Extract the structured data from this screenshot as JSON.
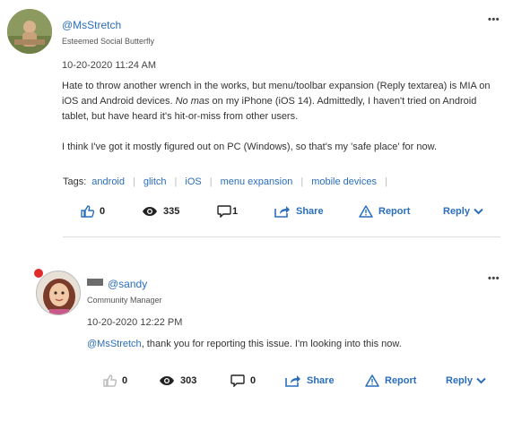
{
  "posts": [
    {
      "username": "@MsStretch",
      "rank": "Esteemed Social Butterfly",
      "timestamp": "10-20-2020 11:24 AM",
      "body": {
        "p1_a": "Hate to throw another wrench in the works, but menu/toolbar expansion (Reply textarea) is MIA on iOS and Android devices.  ",
        "p1_em": "No mas",
        "p1_b": " on my iPhone (iOS 14).  Admittedly, I haven't tried on Android tablet, but have heard it's hit-or-miss from other users.",
        "p2": "I think I've got it mostly figured out on PC (Windows), so that's my 'safe place' for now."
      },
      "tags_label": "Tags:",
      "tags": [
        "android",
        "glitch",
        "iOS",
        "menu expansion",
        "mobile devices"
      ],
      "likes": "0",
      "views": "335",
      "comments": "1",
      "share_label": "Share",
      "report_label": "Report",
      "reply_label": "Reply",
      "more_label": "•••"
    },
    {
      "username": "@sandy",
      "rank": "Community Manager",
      "timestamp": "10-20-2020 12:22 PM",
      "body": {
        "mention": "@MsStretch",
        "text": ", thank you for reporting this issue.  I'm looking into this now."
      },
      "likes": "0",
      "views": "303",
      "comments": "0",
      "share_label": "Share",
      "report_label": "Report",
      "reply_label": "Reply",
      "more_label": "•••"
    }
  ],
  "colors": {
    "link": "#2a6ebb",
    "text": "#333333",
    "divider": "#dddddd",
    "badge": "#e02b2b"
  },
  "icons": [
    "thumbs-up-icon",
    "eye-icon",
    "comment-icon",
    "share-icon",
    "report-icon",
    "chevron-down-icon",
    "more-icon"
  ]
}
